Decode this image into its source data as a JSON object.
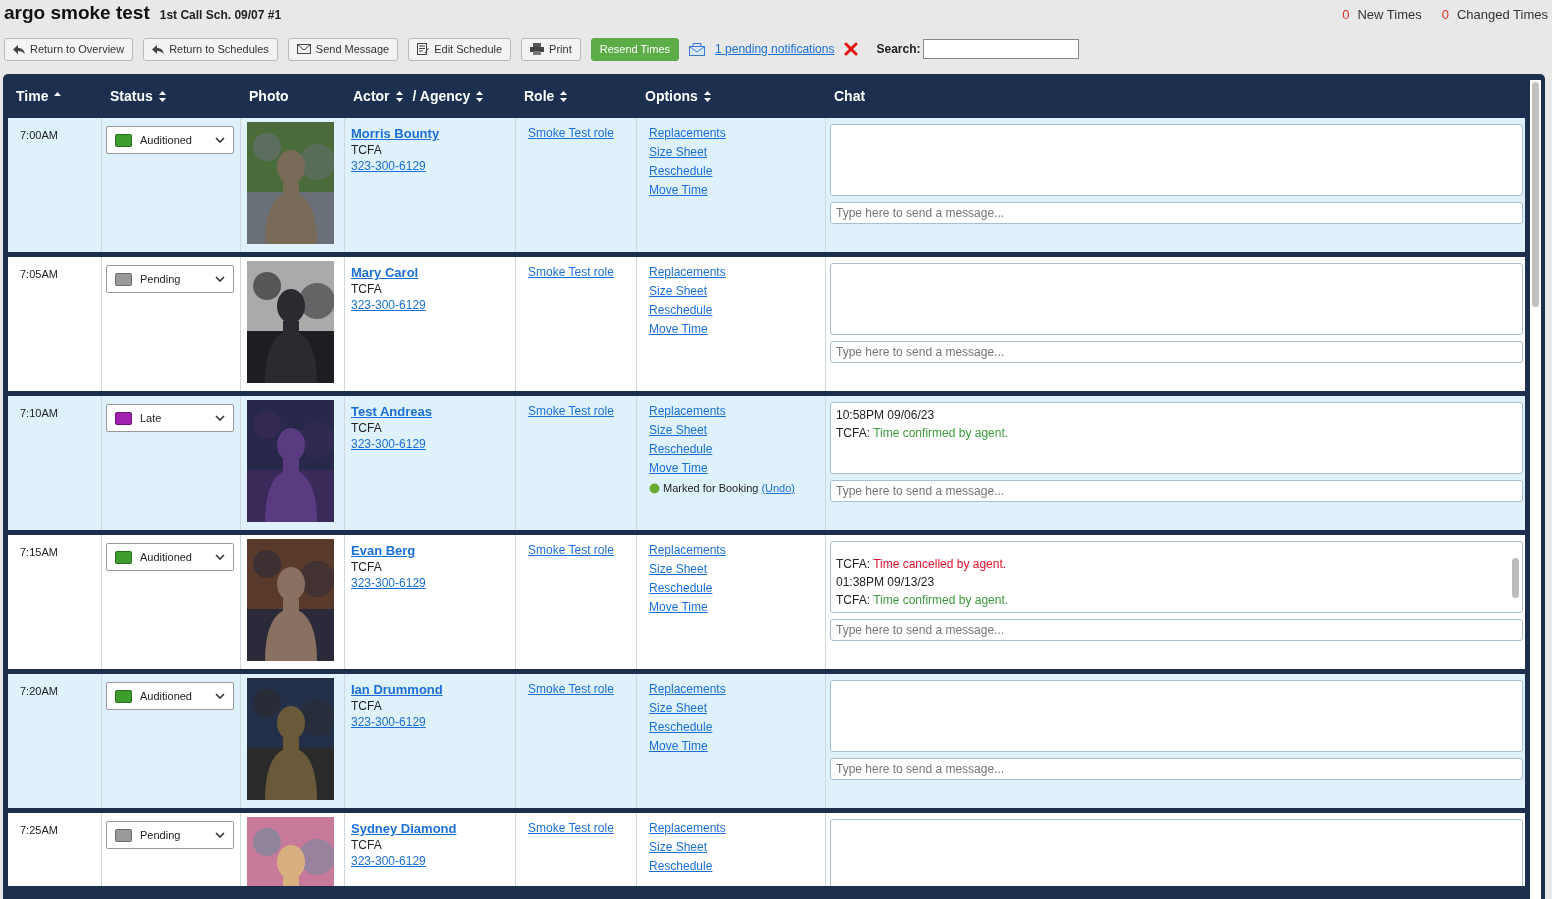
{
  "title": "argo smoke test",
  "subtitle": "1st Call Sch. 09/07 #1",
  "counters": [
    {
      "count": "0",
      "label": "New Times"
    },
    {
      "count": "0",
      "label": "Changed Times"
    }
  ],
  "toolbar": [
    {
      "kind": "back",
      "label": "Return to Overview"
    },
    {
      "kind": "back",
      "label": "Return to Schedules"
    },
    {
      "kind": "mail",
      "label": "Send Message"
    },
    {
      "kind": "edit",
      "label": "Edit Schedule"
    },
    {
      "kind": "print",
      "label": "Print"
    },
    {
      "kind": "primary",
      "label": "Resend Times"
    }
  ],
  "notifications": {
    "label": "1 pending notifications"
  },
  "search": {
    "label": "Search:"
  },
  "columns": [
    {
      "label": "Time",
      "sortable": true,
      "sorted": true
    },
    {
      "label": "Status",
      "sortable": true,
      "sorted": false
    },
    {
      "label": "Photo",
      "sortable": false
    },
    {
      "label": "Actor",
      "sortable": true,
      "sorted": false
    },
    {
      "label": "/ Agency",
      "sortable": true,
      "sorted": false
    },
    {
      "label": "Role",
      "sortable": true,
      "sorted": false
    },
    {
      "label": "Options",
      "sortable": true,
      "sorted": false
    },
    {
      "label": "Chat",
      "sortable": false
    }
  ],
  "rows": [
    {
      "time": "7:00AM",
      "status": "Auditioned",
      "color": "#3c9c2c",
      "name": "Morris Bounty",
      "agency": "TCFA",
      "phone": "323-300-6129",
      "role": "Smoke Test role",
      "options": [
        "Replacements",
        "Size Sheet",
        "Reschedule",
        "Move Time"
      ],
      "chat": [],
      "placeholder": "Type here to send a message..."
    },
    {
      "time": "7:05AM",
      "status": "Pending",
      "color": "#9a9a9a",
      "name": "Mary Carol",
      "agency": "TCFA",
      "phone": "323-300-6129",
      "role": "Smoke Test role",
      "options": [
        "Replacements",
        "Size Sheet",
        "Reschedule",
        "Move Time"
      ],
      "chat": [],
      "placeholder": "Type here to send a message..."
    },
    {
      "time": "7:10AM",
      "status": "Late",
      "color": "#a020b0",
      "name": "Test Andreas",
      "agency": "TCFA",
      "phone": "323-300-6129",
      "role": "Smoke Test role",
      "options": [
        "Replacements",
        "Size Sheet",
        "Reschedule",
        "Move Time"
      ],
      "booking": {
        "label": "Marked for Booking",
        "undo": "(Undo)"
      },
      "chat": [
        {
          "kind": "stamp",
          "text": "10:58PM 09/06/23"
        },
        {
          "kind": "message",
          "sender": "TCFA:",
          "text": "Time confirmed by agent.",
          "color": "#3c9a3c"
        }
      ],
      "placeholder": "Type here to send a message..."
    },
    {
      "time": "7:15AM",
      "status": "Auditioned",
      "color": "#3c9c2c",
      "name": "Evan Berg",
      "agency": "TCFA",
      "phone": "323-300-6129",
      "role": "Smoke Test role",
      "options": [
        "Replacements",
        "Size Sheet",
        "Reschedule",
        "Move Time"
      ],
      "chat_scrolled": true,
      "chat": [
        {
          "kind": "message",
          "sender": "TCFA:",
          "text": "Time cancelled by agent.",
          "color": "#e0102a"
        },
        {
          "kind": "stamp",
          "text": "01:38PM 09/13/23"
        },
        {
          "kind": "message",
          "sender": "TCFA:",
          "text": "Time confirmed by agent.",
          "color": "#3c9a3c"
        }
      ],
      "placeholder": "Type here to send a message..."
    },
    {
      "time": "7:20AM",
      "status": "Auditioned",
      "color": "#3c9c2c",
      "name": "Ian Drummond",
      "agency": "TCFA",
      "phone": "323-300-6129",
      "role": "Smoke Test role",
      "options": [
        "Replacements",
        "Size Sheet",
        "Reschedule",
        "Move Time"
      ],
      "chat": [],
      "placeholder": "Type here to send a message..."
    },
    {
      "time": "7:25AM",
      "status": "Pending",
      "color": "#9a9a9a",
      "name": "Sydney Diamond",
      "agency": "TCFA",
      "phone": "323-300-6129",
      "role": "Smoke Test role",
      "options": [
        "Replacements",
        "Size Sheet",
        "Reschedule"
      ],
      "chat": []
    }
  ]
}
